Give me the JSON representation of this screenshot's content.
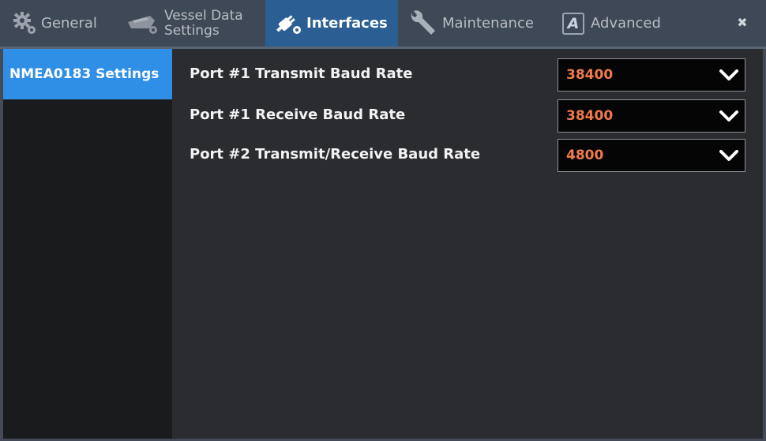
{
  "tabs": {
    "general": "General",
    "vessel_line1": "Vessel Data",
    "vessel_line2": "Settings",
    "interfaces": "Interfaces",
    "maintenance": "Maintenance",
    "advanced": "Advanced",
    "advanced_icon_letter": "A",
    "close": "✖"
  },
  "sidebar": {
    "items": [
      {
        "label": "NMEA0183 Settings",
        "active": true
      }
    ]
  },
  "settings": [
    {
      "label": "Port #1 Transmit Baud Rate",
      "value": "38400"
    },
    {
      "label": "Port #1 Receive Baud Rate",
      "value": "38400"
    },
    {
      "label": "Port #2 Transmit/Receive Baud Rate",
      "value": "4800"
    }
  ],
  "colors": {
    "active_tab": "#2b5f93",
    "active_side_item": "#2f8fe6",
    "value_text": "#f07a4a"
  },
  "icons": {
    "general": "gears-icon",
    "vessel": "ship-gear-icon",
    "interfaces": "plug-gear-icon",
    "maintenance": "wrench-icon",
    "advanced": "letter-a-icon",
    "dropdown": "chevron-down-icon"
  }
}
